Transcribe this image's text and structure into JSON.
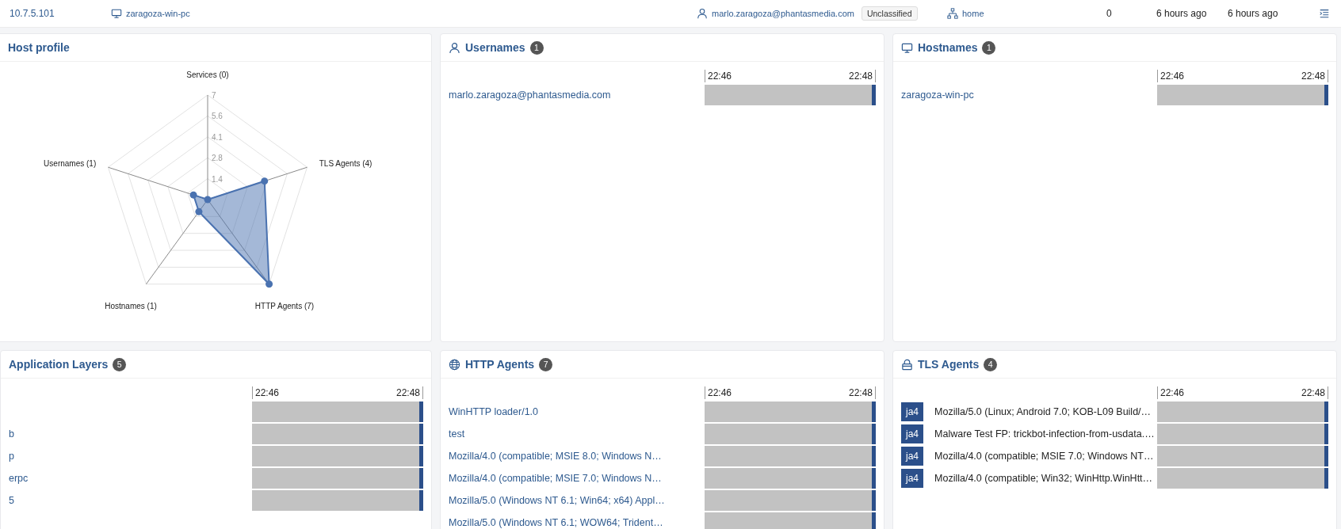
{
  "top_bar": {
    "ip": "10.7.5.101",
    "hostname": "zaragoza-win-pc",
    "username": "marlo.zaragoza@phantasmedia.com",
    "classification": "Unclassified",
    "network": "home",
    "count": "0",
    "first_seen": "6 hours ago",
    "last_seen": "6 hours ago"
  },
  "host_profile": {
    "title": "Host profile",
    "scale_labels": [
      "7",
      "5.6",
      "4.1",
      "2.8",
      "1.4"
    ],
    "spoke_labels": [
      "Services (0)",
      "Usernames (1)",
      "TLS Agents (4)",
      "Hostnames (1)",
      "HTTP Agents (7)"
    ]
  },
  "panels": [
    {
      "title": "Usernames",
      "count": "1",
      "axis": [
        "22:46",
        "22:48"
      ],
      "rows": [
        {
          "label": "marlo.zaragoza@phantasmedia.com"
        }
      ]
    },
    {
      "title": "Hostnames",
      "count": "1",
      "axis": [
        "22:46",
        "22:48"
      ],
      "rows": [
        {
          "label": "zaragoza-win-pc"
        }
      ]
    },
    {
      "title": "Application Layers",
      "count": "5",
      "axis": [
        "22:46",
        "22:48"
      ],
      "rows": [
        {},
        {
          "label": "b"
        },
        {
          "label": "p"
        },
        {
          "label": "erpc"
        },
        {
          "label": "5"
        }
      ]
    },
    {
      "title": "HTTP Agents",
      "count": "7",
      "axis": [
        "22:46",
        "22:48"
      ],
      "rows": [
        {
          "label": "WinHTTP loader/1.0"
        },
        {
          "label": "test"
        },
        {
          "label": "Mozilla/4.0 (compatible; MSIE 8.0; Windows N…"
        },
        {
          "label": "Mozilla/4.0 (compatible; MSIE 7.0; Windows N…"
        },
        {
          "label": "Mozilla/5.0 (Windows NT 6.1; Win64; x64) Appl…"
        },
        {
          "label": "Mozilla/5.0 (Windows NT 6.1; WOW64; Trident…"
        }
      ]
    },
    {
      "title": "TLS Agents",
      "count": "4",
      "axis": [
        "22:46",
        "22:48"
      ],
      "rows": [
        {
          "tag": "ja4",
          "label": "Mozilla/5.0 (Linux; Android 7.0; KOB-L09 Build/…"
        },
        {
          "tag": "ja4",
          "label": "Malware Test FP: trickbot-infection-from-usdata.…"
        },
        {
          "tag": "ja4",
          "label": "Mozilla/4.0 (compatible; MSIE 7.0; Windows NT…"
        },
        {
          "tag": "ja4",
          "label": "Mozilla/4.0 (compatible; Win32; WinHttp.WinHtt…"
        }
      ]
    }
  ]
}
